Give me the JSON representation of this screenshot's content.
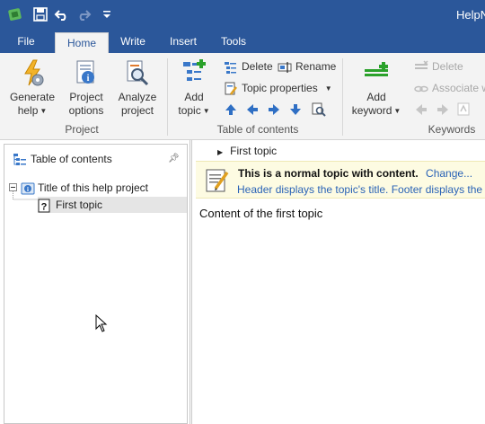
{
  "titlebar": {
    "title": "HelpN",
    "background": "#2b579a"
  },
  "tabs": [
    {
      "label": "File"
    },
    {
      "label": "Home"
    },
    {
      "label": "Write"
    },
    {
      "label": "Insert"
    },
    {
      "label": "Tools"
    }
  ],
  "ribbon": {
    "project": {
      "generate_help": "Generate help",
      "project_options": "Project options",
      "analyze_project": "Analyze project",
      "group_label": "Project"
    },
    "toc": {
      "add_topic": "Add topic",
      "delete": "Delete",
      "rename": "Rename",
      "topic_properties": "Topic properties",
      "group_label": "Table of contents"
    },
    "keywords": {
      "add_keyword": "Add keyword",
      "delete": "Delete",
      "associate": "Associate w",
      "group_label": "Keywords"
    }
  },
  "left_pane": {
    "title": "Table of contents",
    "tree": [
      {
        "label": "Title of this help project"
      },
      {
        "label": "First topic"
      }
    ]
  },
  "content": {
    "breadcrumb": "First topic",
    "info_bold": "This is a normal topic with content.",
    "info_change": "Change...",
    "info_line2": "Header displays the topic's title.   Footer displays the proj",
    "body_text": "Content of the first topic"
  },
  "icons": [
    "app-icon",
    "save-icon",
    "undo-icon",
    "redo-icon",
    "customize-icon",
    "generate-help-icon",
    "project-options-icon",
    "analyze-project-icon",
    "add-topic-icon",
    "delete-icon",
    "rename-icon",
    "topic-properties-icon",
    "arrow-up-icon",
    "arrow-left-icon",
    "arrow-right-icon",
    "arrow-down-icon",
    "find-icon",
    "add-keyword-icon",
    "toc-icon",
    "pin-icon",
    "book-icon",
    "question-page-icon",
    "note-icon"
  ]
}
